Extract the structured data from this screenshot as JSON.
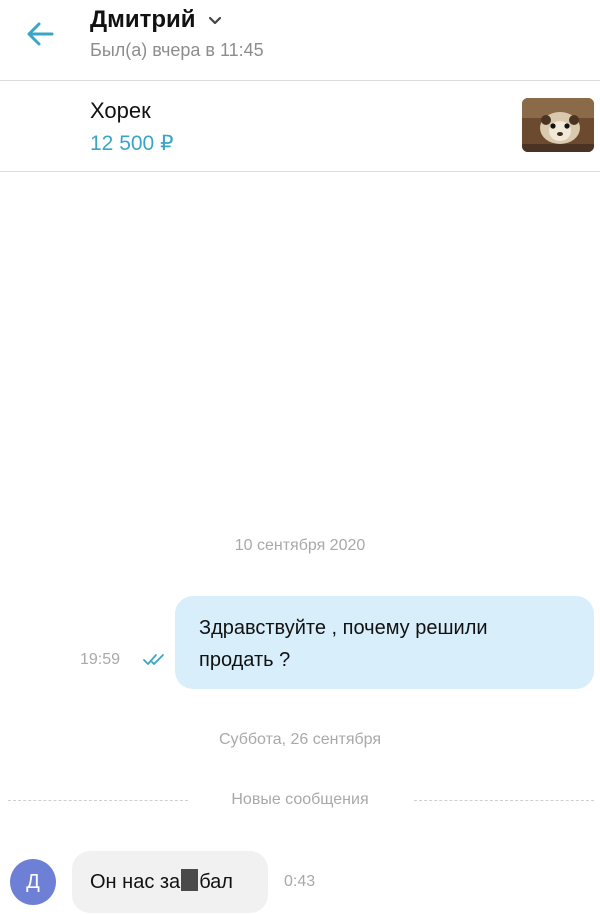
{
  "header": {
    "title": "Дмитрий",
    "subtitle": "Был(а) вчера в 11:45"
  },
  "listing": {
    "name": "Хорек",
    "price": "12 500 ₽"
  },
  "chat": {
    "date_1": "10 сентября 2020",
    "outgoing": {
      "line1": "Здравствуйте , почему решили",
      "line2": "продать ?",
      "time": "19:59"
    },
    "date_2": "Суббота, 26 сентября",
    "new_messages_label": "Новые сообщения",
    "incoming": {
      "avatar_letter": "Д",
      "text_before": "Он нас за",
      "text_after": "бал",
      "time": "0:43"
    }
  },
  "colors": {
    "accent": "#3aa6c6",
    "outgoing_bubble": "#d8eefb",
    "incoming_bubble": "#f1f1f1",
    "avatar": "#6e7fd6"
  }
}
